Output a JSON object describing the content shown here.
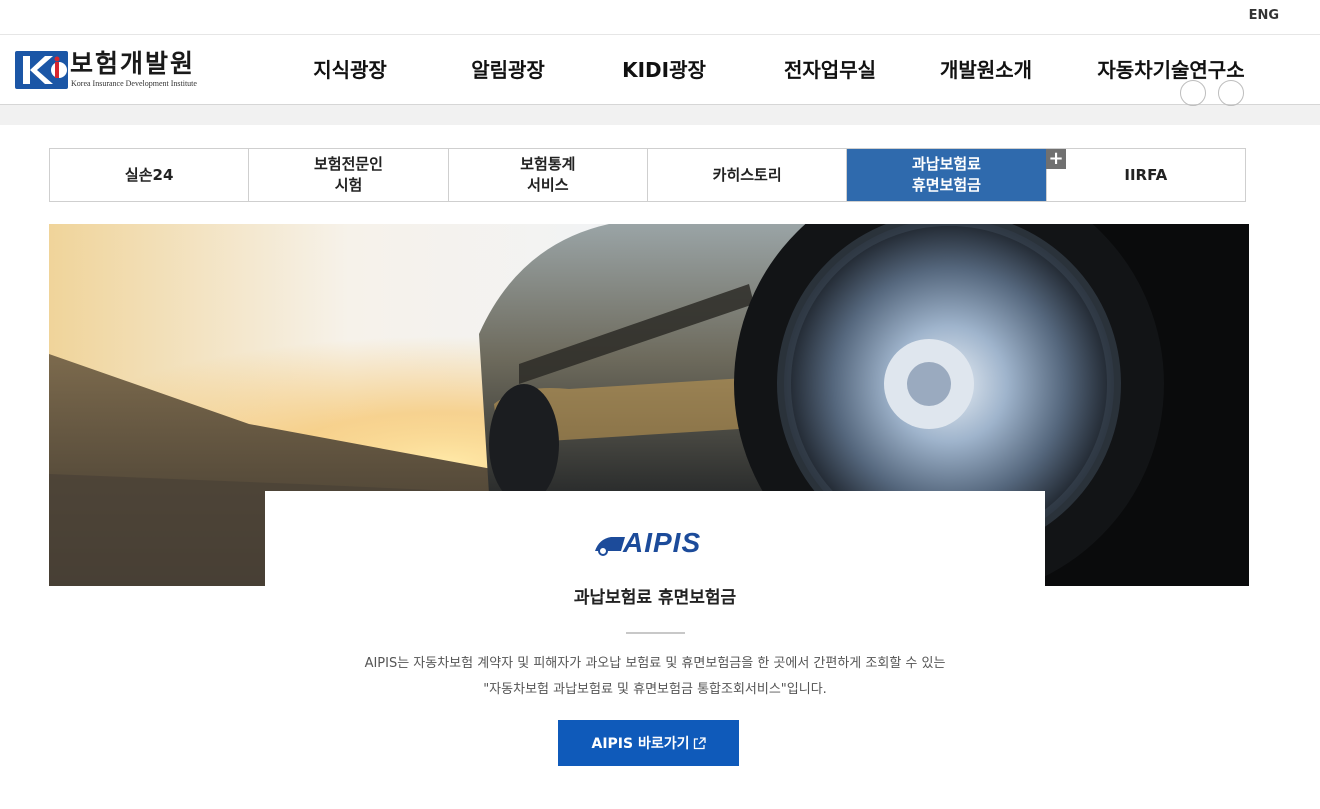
{
  "topbar": {
    "lang_label": "ENG"
  },
  "logo": {
    "name_ko": "보험개발원",
    "name_en": "Korea Insurance Development Institute"
  },
  "nav": [
    {
      "label": "지식광장"
    },
    {
      "label": "알림광장"
    },
    {
      "label": "KIDI광장"
    },
    {
      "label": "전자업무실"
    },
    {
      "label": "개발원소개"
    },
    {
      "label": "자동차기술연구소"
    }
  ],
  "tabs": [
    {
      "label": "실손24",
      "active": false
    },
    {
      "label": "보험전문인\n시험",
      "active": false
    },
    {
      "label": "보험통계\n서비스",
      "active": false
    },
    {
      "label": "카히스토리",
      "active": false
    },
    {
      "label": "과납보험료\n휴면보험금",
      "active": true
    },
    {
      "label": "IIRFA",
      "active": false
    }
  ],
  "plus_label": "+",
  "card": {
    "brand": "AIPIS",
    "title": "과납보험료 휴면보험금",
    "desc_line1": "AIPIS는 자동차보험 계약자 및 피해자가 과오납 보험료 및 휴면보험금을 한 곳에서 간편하게 조회할 수 있는",
    "desc_line2": "\"자동차보험 과납보험료 및 휴면보험금 통합조회서비스\"입니다.",
    "button_label": "AIPIS 바로가기"
  },
  "colors": {
    "active_tab": "#2f6aad",
    "button": "#0f5aba",
    "brand": "#1c4b9a",
    "logo_blue": "#1b56a6",
    "logo_red": "#d7262e"
  },
  "icons": {
    "external_link": "external-link-icon",
    "plus": "plus-icon"
  }
}
